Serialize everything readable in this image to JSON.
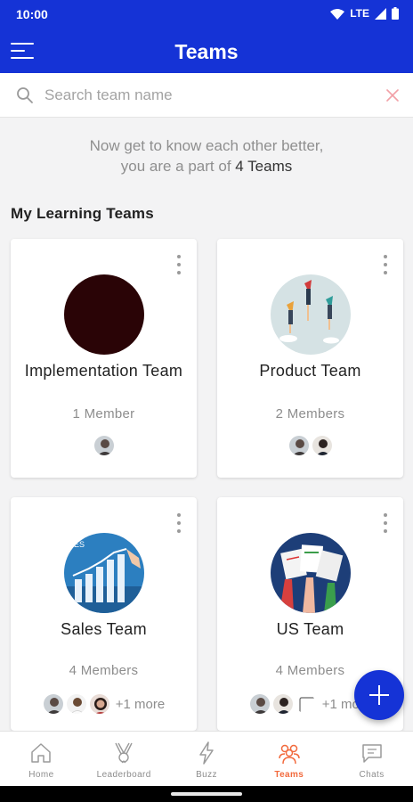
{
  "status_bar": {
    "time": "10:00",
    "network": "LTE"
  },
  "header": {
    "title": "Teams"
  },
  "search": {
    "placeholder": "Search team name",
    "value": ""
  },
  "intro": {
    "line1": "Now get to know each other better,",
    "line2_prefix": "you are a part of",
    "line2_count": "4 Teams"
  },
  "section": {
    "title": "My Learning Teams"
  },
  "teams": [
    {
      "name": "Implementation Team",
      "members_label": "1 Member",
      "avatar": "dark-red-circle",
      "more": ""
    },
    {
      "name": "Product Team",
      "members_label": "2 Members",
      "avatar": "rocket-people-illustration",
      "more": ""
    },
    {
      "name": "Sales Team",
      "members_label": "4 Members",
      "avatar": "sales-chart-illustration",
      "more": "+1 more"
    },
    {
      "name": "US Team",
      "members_label": "4 Members",
      "avatar": "raised-hands-documents-illustration",
      "more": "+1 more"
    }
  ],
  "nav": [
    {
      "label": "Home",
      "icon": "home-icon",
      "active": false
    },
    {
      "label": "Leaderboard",
      "icon": "trophy-icon",
      "active": false
    },
    {
      "label": "Buzz",
      "icon": "lightning-icon",
      "active": false
    },
    {
      "label": "Teams",
      "icon": "team-icon",
      "active": true
    },
    {
      "label": "Chats",
      "icon": "chat-icon",
      "active": false
    }
  ],
  "colors": {
    "primary": "#1533d6",
    "accent": "#f26a3d",
    "background": "#f3f3f4",
    "muted_text": "#8d8d8d"
  }
}
